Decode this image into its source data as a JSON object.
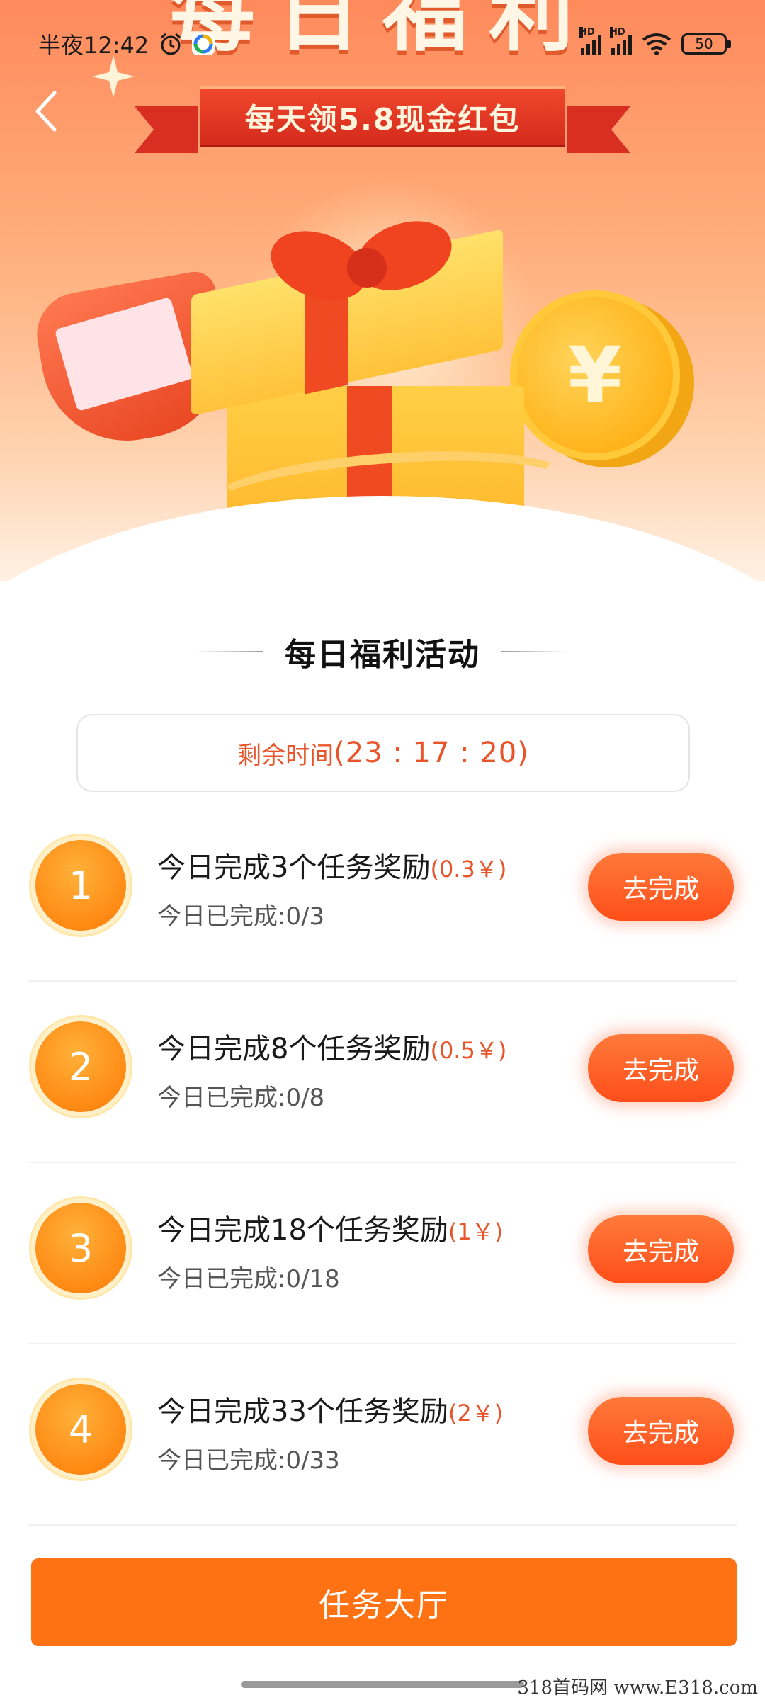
{
  "status_bar": {
    "time": "半夜12:42",
    "battery": "50"
  },
  "banner": {
    "big_title": "每日福利",
    "ribbon_text": "每天领5.8现金红包",
    "coin_symbol": "¥"
  },
  "section": {
    "title": "每日福利活动"
  },
  "timer": {
    "label": "剩余时间",
    "value": "(23 : 17 : 20)"
  },
  "tasks": [
    {
      "number": "1",
      "title": "今日完成3个任务奖励",
      "reward": "(0.3￥)",
      "progress": "今日已完成:0/3",
      "button": "去完成"
    },
    {
      "number": "2",
      "title": "今日完成8个任务奖励",
      "reward": "(0.5￥)",
      "progress": "今日已完成:0/8",
      "button": "去完成"
    },
    {
      "number": "3",
      "title": "今日完成18个任务奖励",
      "reward": "(1￥)",
      "progress": "今日已完成:0/18",
      "button": "去完成"
    },
    {
      "number": "4",
      "title": "今日完成33个任务奖励",
      "reward": "(2￥)",
      "progress": "今日已完成:0/33",
      "button": "去完成"
    }
  ],
  "footer": {
    "hall_button": "任务大厅",
    "watermark": "318首码网 www.E318.com"
  },
  "colors": {
    "accent": "#ff7214",
    "reward_text": "#e8552a",
    "button_gradient_top": "#ff7a3a",
    "button_gradient_bottom": "#ff4e1a"
  }
}
